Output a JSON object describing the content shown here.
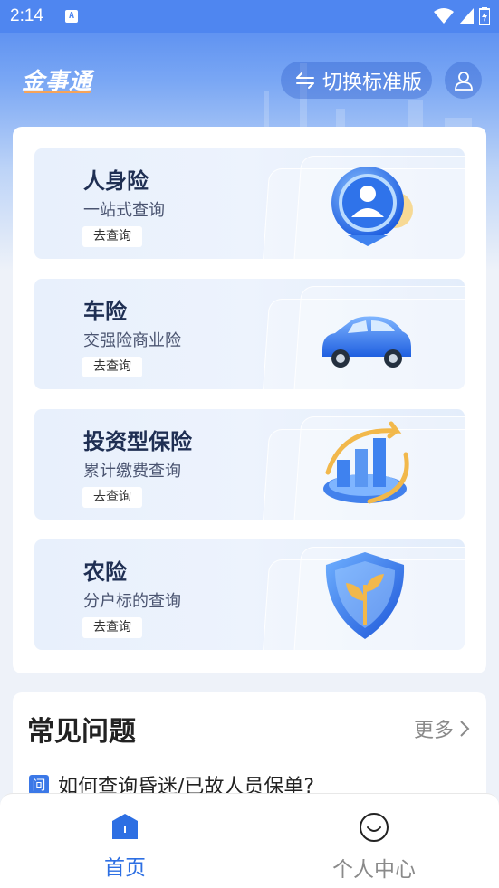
{
  "status_bar": {
    "time": "2:14",
    "notif_letter": "A"
  },
  "header": {
    "logo": "金事通",
    "switch_label": "切换标准版"
  },
  "cards": [
    {
      "title": "人身险",
      "subtitle": "一站式查询",
      "button": "去查询",
      "icon": "person-shield-icon"
    },
    {
      "title": "车险",
      "subtitle": "交强险商业险",
      "button": "去查询",
      "icon": "car-icon"
    },
    {
      "title": "投资型保险",
      "subtitle": "累计缴费查询",
      "button": "去查询",
      "icon": "growth-chart-icon"
    },
    {
      "title": "农险",
      "subtitle": "分户标的查询",
      "button": "去查询",
      "icon": "plant-shield-icon"
    }
  ],
  "faq": {
    "title": "常见问题",
    "more": "更多",
    "badge": "问",
    "question": "如何查询昏迷/已故人员保单?"
  },
  "tabbar": {
    "home": "首页",
    "me": "个人中心",
    "active_color": "#2d6fe3",
    "inactive_color": "#8a8a8a"
  },
  "colors": {
    "brand": "#4f86f0",
    "accent": "#f5a35a"
  }
}
